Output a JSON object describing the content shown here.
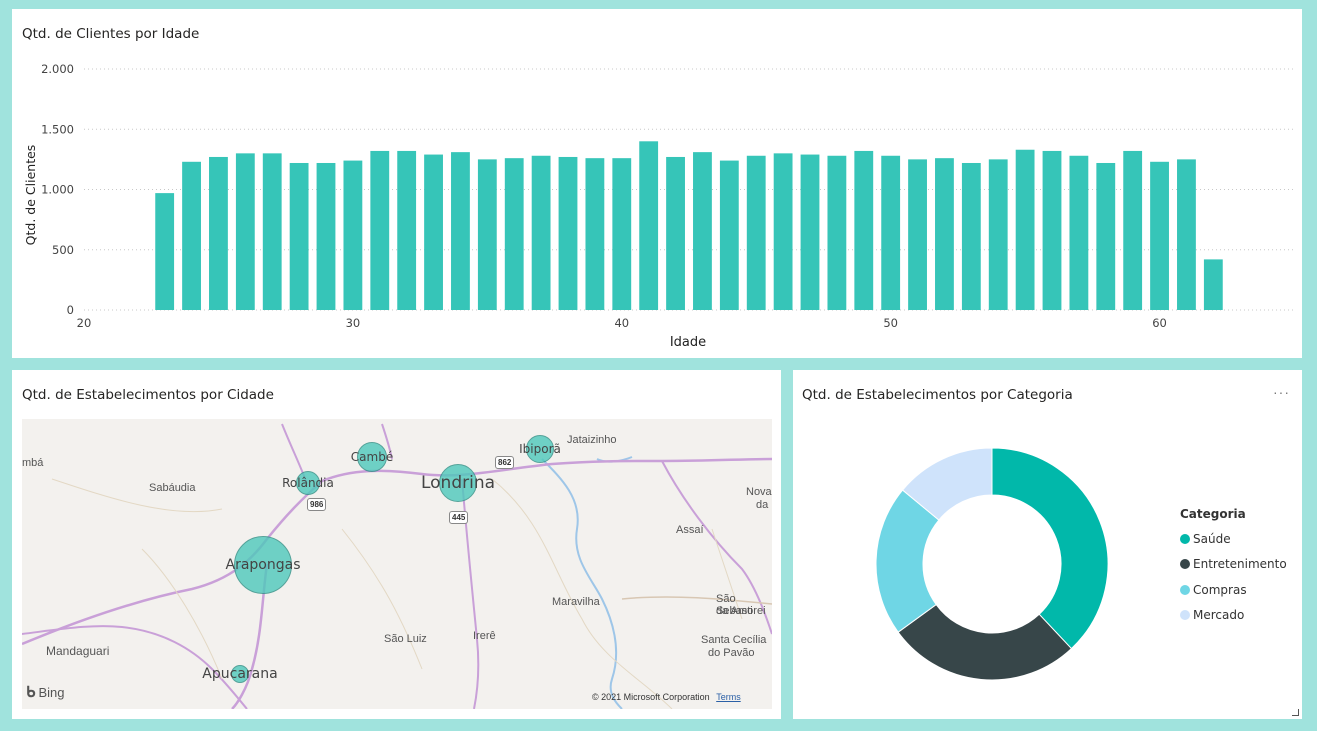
{
  "panels": {
    "bar_title": "Qtd. de Clientes por Idade",
    "map_title": "Qtd. de Estabelecimentos por Cidade",
    "donut_title": "Qtd. de Estabelecimentos por Categoria",
    "more_label": "···"
  },
  "chart_data": [
    {
      "type": "bar",
      "title": "Qtd. de Clientes por Idade",
      "xlabel": "Idade",
      "ylabel": "Qtd. de Clientes",
      "x": [
        23,
        24,
        25,
        26,
        27,
        28,
        29,
        30,
        31,
        32,
        33,
        34,
        35,
        36,
        37,
        38,
        39,
        40,
        41,
        42,
        43,
        44,
        45,
        46,
        47,
        48,
        49,
        50,
        51,
        52,
        53,
        54,
        55,
        56,
        57,
        58,
        59,
        60,
        61,
        62
      ],
      "values": [
        970,
        1230,
        1270,
        1300,
        1300,
        1220,
        1220,
        1240,
        1320,
        1320,
        1290,
        1310,
        1250,
        1260,
        1280,
        1270,
        1260,
        1260,
        1400,
        1270,
        1310,
        1240,
        1280,
        1300,
        1290,
        1280,
        1320,
        1280,
        1250,
        1260,
        1220,
        1250,
        1330,
        1320,
        1280,
        1220,
        1320,
        1230,
        1250,
        420
      ],
      "xlim": [
        20,
        65
      ],
      "ylim": [
        0,
        2000
      ],
      "xticks": [
        "20",
        "30",
        "40",
        "50",
        "60"
      ],
      "yticks": [
        "0",
        "500",
        "1.000",
        "1.500",
        "2.000"
      ],
      "grid": true,
      "color": "#36c5b8"
    },
    {
      "type": "pie",
      "title": "Qtd. de Estabelecimentos por Categoria",
      "legend_title": "Categoria",
      "legend_position": "right",
      "categories": [
        "Saúde",
        "Entretenimento",
        "Compras",
        "Mercado"
      ],
      "values": [
        38,
        27,
        21,
        14
      ],
      "colors": [
        "#01b8aa",
        "#374649",
        "#6fd6e5",
        "#cfe3fb"
      ]
    }
  ],
  "map": {
    "bubble_color": "#4ec9bb",
    "cities": [
      {
        "name": "Cambé",
        "size": 15
      },
      {
        "name": "Ibiporã",
        "size": 14
      },
      {
        "name": "Rolândia",
        "size": 12
      },
      {
        "name": "Londrina",
        "size": 19
      },
      {
        "name": "Arapongas",
        "size": 29
      },
      {
        "name": "Apucarana",
        "size": 9
      }
    ],
    "place_labels": [
      "mbá",
      "Sabáudia",
      "Jataizinho",
      "Nova",
      "da",
      "Assaí",
      "Maravilha",
      "São Sebasti",
      "da Amorei",
      "Santa Cecília",
      "do Pavão",
      "São Luiz",
      "Irerê",
      "Mandaguari"
    ],
    "roads": [
      "862",
      "986",
      "445"
    ],
    "attribution": "© 2021 Microsoft Corporation",
    "terms": "Terms",
    "bing": "Bing"
  }
}
